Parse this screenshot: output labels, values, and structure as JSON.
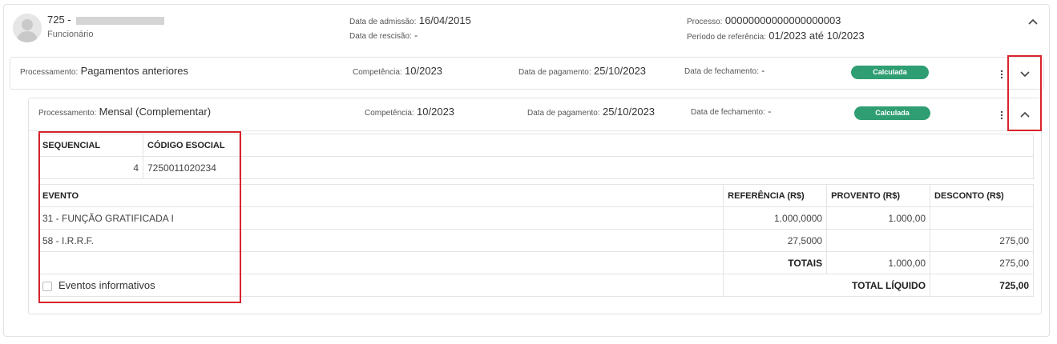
{
  "employee": {
    "id": "725 -",
    "role": "Funcionário",
    "admissao_label": "Data de admissão:",
    "admissao_value": "16/04/2015",
    "rescisao_label": "Data de rescisão:",
    "rescisao_value": "-",
    "processo_label": "Processo:",
    "processo_value": "00000000000000000003",
    "periodo_label": "Período de referência:",
    "periodo_value": "01/2023 até 10/2023"
  },
  "proc1": {
    "processamento_label": "Processamento:",
    "processamento_value": "Pagamentos anteriores",
    "competencia_label": "Competência:",
    "competencia_value": "10/2023",
    "pagamento_label": "Data de pagamento:",
    "pagamento_value": "25/10/2023",
    "fechamento_label": "Data de fechamento:",
    "fechamento_value": "-",
    "status": "Calculada"
  },
  "proc2": {
    "processamento_label": "Processamento:",
    "processamento_value": "Mensal (Complementar)",
    "competencia_label": "Competência:",
    "competencia_value": "10/2023",
    "pagamento_label": "Data de pagamento:",
    "pagamento_value": "25/10/2023",
    "fechamento_label": "Data de fechamento:",
    "fechamento_value": "-",
    "status": "Calculada"
  },
  "seq_table": {
    "headers": [
      "SEQUENCIAL",
      "CÓDIGO ESOCIAL"
    ],
    "row": [
      "4",
      "7250011020234"
    ]
  },
  "events_table": {
    "headers": [
      "EVENTO",
      "REFERÊNCIA (R$)",
      "PROVENTO (R$)",
      "DESCONTO (R$)"
    ],
    "rows": [
      [
        "31 - FUNÇÃO GRATIFICADA I",
        "1.000,0000",
        "1.000,00",
        ""
      ],
      [
        "58 - I.R.R.F.",
        "27,5000",
        "",
        "275,00"
      ]
    ],
    "totais_label": "TOTAIS",
    "totais_provento": "1.000,00",
    "totais_desconto": "275,00",
    "eventos_informativos": "Eventos informativos",
    "total_liquido_label": "TOTAL LÍQUIDO",
    "total_liquido_value": "725,00"
  },
  "icons": {
    "avatar": "user-avatar-icon",
    "collapse": "chevron-up-icon",
    "expand": "chevron-down-icon",
    "menu": "vertical-dots-icon"
  },
  "colors": {
    "badge": "#2f9e72",
    "highlight": "#d9232e"
  }
}
